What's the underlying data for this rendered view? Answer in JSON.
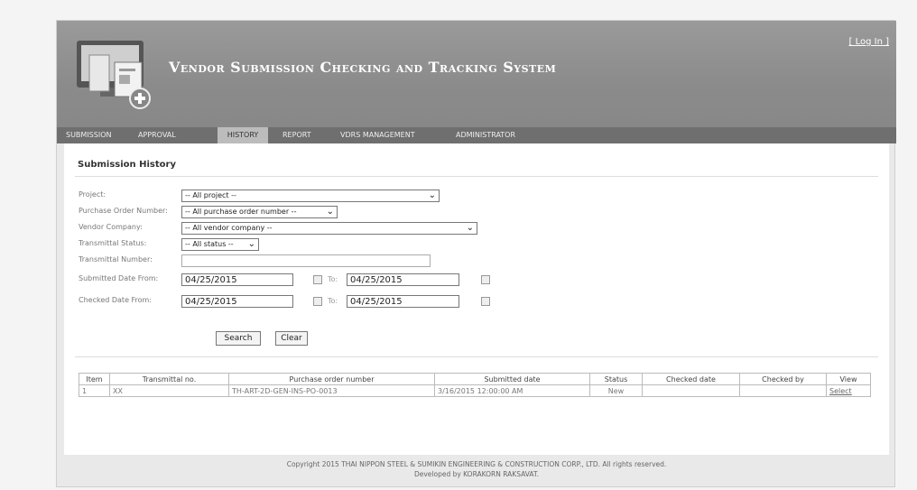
{
  "header": {
    "title": "Vendor Submission Checking and Tracking System",
    "login_label": "Log In"
  },
  "nav": {
    "items": [
      "SUBMISSION",
      "APPROVAL",
      "HISTORY",
      "REPORT",
      "VDRS MANAGEMENT",
      "ADMINISTRATOR"
    ],
    "active": "HISTORY"
  },
  "page": {
    "section_title": "Submission History"
  },
  "filters": {
    "project": {
      "label": "Project:",
      "value": "-- All project --"
    },
    "po_number": {
      "label": "Purchase Order Number:",
      "value": "-- All purchase order number --"
    },
    "vendor_company": {
      "label": "Vendor Company:",
      "value": "-- All vendor company --"
    },
    "status": {
      "label": "Transmittal Status:",
      "value": "-- All status --"
    },
    "transmittal_number": {
      "label": "Transmittal Number:",
      "value": ""
    },
    "submitted_date": {
      "label": "Submitted Date From:",
      "from": "04/25/2015",
      "to_label": "To:",
      "to": "04/25/2015"
    },
    "checked_date": {
      "label": "Checked Date From:",
      "from": "04/25/2015",
      "to_label": "To:",
      "to": "04/25/2015"
    },
    "search_label": "Search",
    "clear_label": "Clear"
  },
  "table": {
    "columns": [
      "Item",
      "Transmittal no.",
      "Purchase order number",
      "Submitted date",
      "Status",
      "Checked date",
      "Checked by",
      "View"
    ],
    "rows": [
      {
        "item": "1",
        "transmittal_no": "XX",
        "po_number": "TH-ART-2D-GEN-INS-PO-0013",
        "submitted_date": "3/16/2015 12:00:00 AM",
        "status": "New",
        "checked_date": "",
        "checked_by": "",
        "view": "Select"
      }
    ]
  },
  "footer": {
    "line1": "Copyright 2015 THAI NIPPON STEEL & SUMIKIN ENGINEERING & CONSTRUCTION CORP., LTD. All rights reserved.",
    "line2": "Developed by KORAKORN RAKSAVAT."
  }
}
